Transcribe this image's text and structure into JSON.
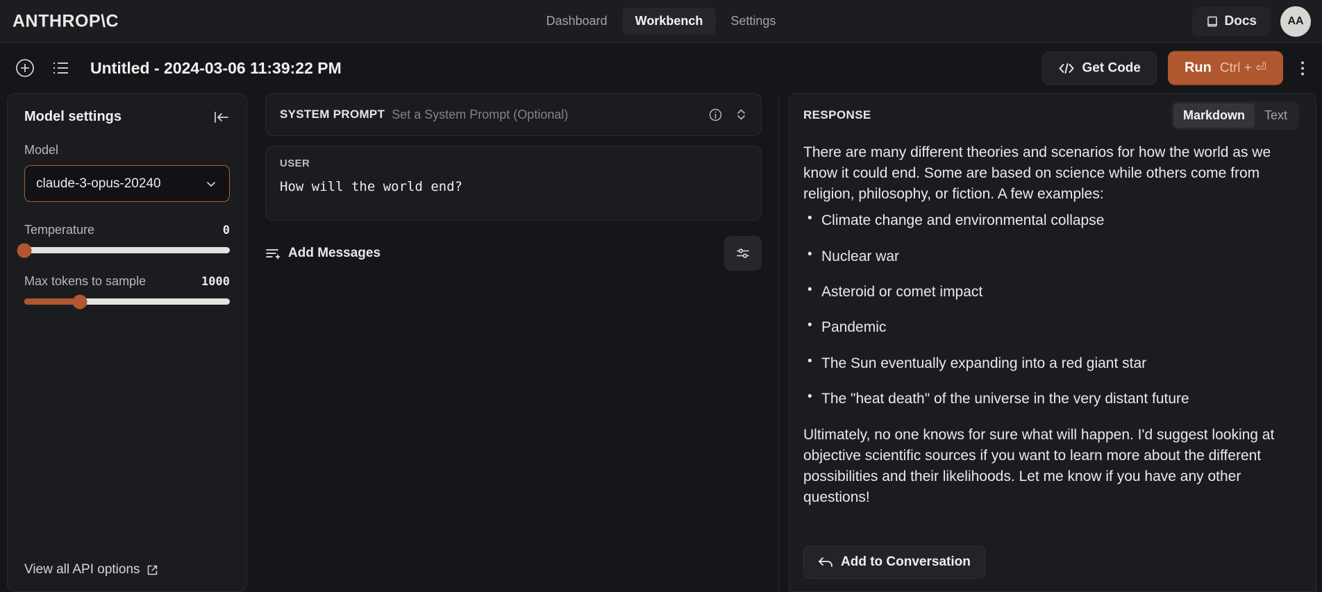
{
  "header": {
    "brand": "ANTHROP\\C",
    "nav": [
      {
        "label": "Dashboard",
        "active": false
      },
      {
        "label": "Workbench",
        "active": true
      },
      {
        "label": "Settings",
        "active": false
      }
    ],
    "docs_label": "Docs",
    "avatar_initials": "AA"
  },
  "toolbar": {
    "title": "Untitled - 2024-03-06 11:39:22 PM",
    "get_code_label": "Get Code",
    "run_label": "Run",
    "run_shortcut": "Ctrl + ⏎"
  },
  "sidebar": {
    "title": "Model settings",
    "model_label": "Model",
    "model_value": "claude-3-opus-20240",
    "temperature": {
      "label": "Temperature",
      "value": "0",
      "percent": 0
    },
    "max_tokens": {
      "label": "Max tokens to sample",
      "value": "1000",
      "percent": 27
    },
    "api_options_label": "View all API options"
  },
  "center": {
    "system_prompt_label": "SYSTEM PROMPT",
    "system_prompt_placeholder": "Set a System Prompt (Optional)",
    "user_label": "USER",
    "user_text": "How will the world end?",
    "add_messages_label": "Add Messages"
  },
  "response": {
    "title": "RESPONSE",
    "view_modes": [
      {
        "label": "Markdown",
        "active": true
      },
      {
        "label": "Text",
        "active": false
      }
    ],
    "intro": "There are many different theories and scenarios for how the world as we know it could end. Some are based on science while others come from religion, philosophy, or fiction. A few examples:",
    "bullets": [
      "Climate change and environmental collapse",
      "Nuclear war",
      "Asteroid or comet impact",
      "Pandemic",
      "The Sun eventually expanding into a red giant star",
      "The \"heat death\" of the universe in the very distant future"
    ],
    "outro": "Ultimately, no one knows for sure what will happen. I'd suggest looking at objective scientific sources if you want to learn more about the different possibilities and their likelihoods. Let me know if you have any other questions!",
    "add_to_conversation_label": "Add to Conversation"
  },
  "colors": {
    "accent": "#b05730",
    "page_bg": "#15161a",
    "panel_bg": "#1b1c20",
    "text": "#eaeae8"
  }
}
